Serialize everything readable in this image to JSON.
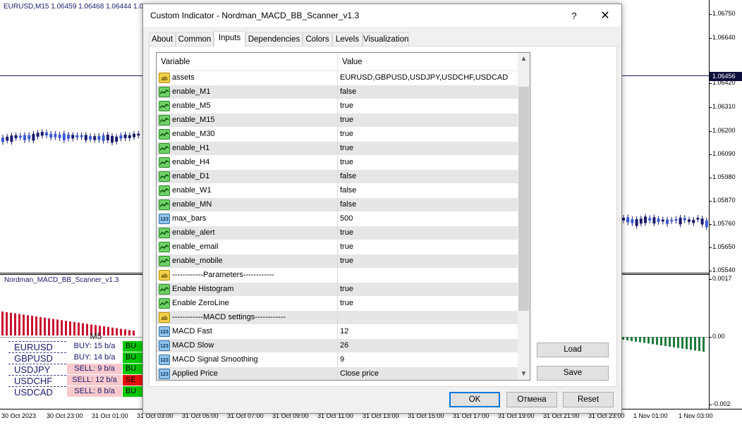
{
  "chart": {
    "symbol_info": "EURUSD,M15  1.06459 1.06468 1.06444 1.0",
    "indicator_name": "Nordman_MACD_BB_Scanner_v1.3",
    "current_price": "1.06456",
    "price_ticks": [
      "1.06750",
      "1.06640",
      "1.06420",
      "1.06310",
      "1.06200",
      "1.06090",
      "1.05980",
      "1.05870",
      "1.05760",
      "1.05650",
      "1.05540"
    ],
    "indicator_ticks": [
      "0.0017",
      "0.00",
      "-0.002"
    ],
    "time_ticks": [
      "30 Oct 2023",
      "30 Oct 23:00",
      "31 Oct 01:00",
      "31 Oct 03:00",
      "31 Oct 05:00",
      "31 Oct 07:00",
      "31 Oct 09:00",
      "31 Oct 11:00",
      "31 Oct 13:00",
      "31 Oct 15:00",
      "31 Oct 17:00",
      "31 Oct 19:00",
      "31 Oct 21:00",
      "31 Oct 23:00",
      "1 Nov 01:00",
      "1 Nov 03:00"
    ],
    "colors": {
      "bull_candle": "#1a1a6e",
      "bear_candle": "#3b5bd6",
      "hist_down": "#c8102e",
      "hist_up": "#1e7a3c",
      "buy_cell": "#00c800",
      "sell_cell": "#e81010",
      "sell_signal_bg": "#f7c9cc"
    }
  },
  "scanner": {
    "timeframe": "M5",
    "rows": [
      {
        "symbol": "EURUSD",
        "signal": "BUY: 15 b/a",
        "type": "buy",
        "cell": "BU"
      },
      {
        "symbol": "GBPUSD",
        "signal": "BUY: 14 b/a",
        "type": "buy",
        "cell": "BU"
      },
      {
        "symbol": "USDJPY",
        "signal": "SELL: 9 b/a",
        "type": "sell",
        "cell": "BU"
      },
      {
        "symbol": "USDCHF",
        "signal": "SELL: 12 b/a",
        "type": "sell",
        "cell": "SE"
      },
      {
        "symbol": "USDCAD",
        "signal": "SELL: 8 b/a",
        "type": "sell",
        "cell": "BU"
      }
    ]
  },
  "dialog": {
    "title": "Custom Indicator - Nordman_MACD_BB_Scanner_v1.3",
    "help": "?",
    "close": "✕",
    "tabs": [
      "About",
      "Common",
      "Inputs",
      "Dependencies",
      "Colors",
      "Levels",
      "Visualization"
    ],
    "active_tab": "Inputs",
    "grid": {
      "col_variable": "Variable",
      "col_value": "Value",
      "rows": [
        {
          "type": "ab",
          "variable": "assets",
          "value": "EURUSD,GBPUSD,USDJPY,USDCHF,USDCAD"
        },
        {
          "type": "bool",
          "variable": "enable_M1",
          "value": "false"
        },
        {
          "type": "bool",
          "variable": "enable_M5",
          "value": "true"
        },
        {
          "type": "bool",
          "variable": "enable_M15",
          "value": "true"
        },
        {
          "type": "bool",
          "variable": "enable_M30",
          "value": "true"
        },
        {
          "type": "bool",
          "variable": "enable_H1",
          "value": "true"
        },
        {
          "type": "bool",
          "variable": "enable_H4",
          "value": "true"
        },
        {
          "type": "bool",
          "variable": "enable_D1",
          "value": "false"
        },
        {
          "type": "bool",
          "variable": "enable_W1",
          "value": "false"
        },
        {
          "type": "bool",
          "variable": "enable_MN",
          "value": "false"
        },
        {
          "type": "num",
          "variable": "max_bars",
          "value": "500"
        },
        {
          "type": "bool",
          "variable": "enable_alert",
          "value": "true"
        },
        {
          "type": "bool",
          "variable": "enable_email",
          "value": "true"
        },
        {
          "type": "bool",
          "variable": "enable_mobile",
          "value": "true"
        },
        {
          "type": "ab",
          "variable": "------------Parameters------------",
          "value": ""
        },
        {
          "type": "bool",
          "variable": "Enable Histogram",
          "value": "true"
        },
        {
          "type": "bool",
          "variable": "Enable ZeroLine",
          "value": "true"
        },
        {
          "type": "ab",
          "variable": "------------MACD settings------------",
          "value": ""
        },
        {
          "type": "num",
          "variable": "MACD Fast",
          "value": "12"
        },
        {
          "type": "num",
          "variable": "MACD Slow",
          "value": "26"
        },
        {
          "type": "num",
          "variable": "MACD Signal Smoothing",
          "value": "9"
        },
        {
          "type": "num",
          "variable": "Applied Price",
          "value": "Close price"
        }
      ]
    },
    "icons": {
      "ab": "ab",
      "bool": "",
      "num": "123"
    },
    "buttons": {
      "load": "Load",
      "save": "Save",
      "ok": "OK",
      "cancel": "Отмена",
      "reset": "Reset"
    }
  }
}
